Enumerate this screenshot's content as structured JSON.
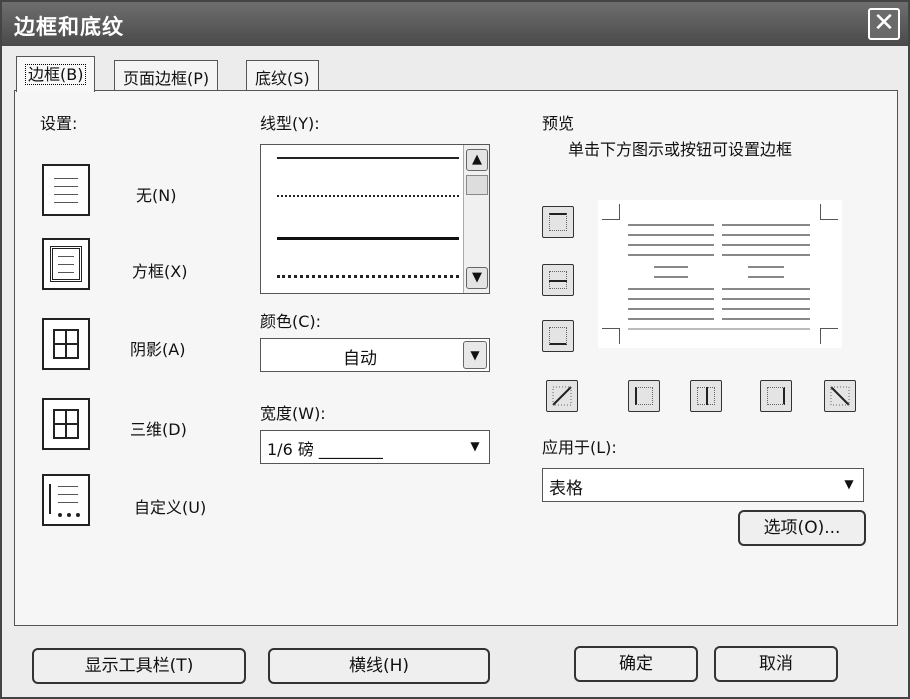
{
  "window": {
    "title": "边框和底纹"
  },
  "tabs": [
    "边框(B)",
    "页面边框(P)",
    "底纹(S)"
  ],
  "settings": {
    "label": "设置:",
    "items": [
      {
        "label": "无(N)",
        "icon": "none-border-icon"
      },
      {
        "label": "方框(X)",
        "icon": "box-border-icon"
      },
      {
        "label": "阴影(A)",
        "icon": "shadow-border-icon"
      },
      {
        "label": "三维(D)",
        "icon": "3d-border-icon"
      },
      {
        "label": "自定义(U)",
        "icon": "custom-border-icon"
      }
    ]
  },
  "line_style": {
    "label": "线型(Y):"
  },
  "color": {
    "label": "颜色(C):",
    "value": "自动"
  },
  "width": {
    "label": "宽度(W):",
    "value": "1/6 磅 ________"
  },
  "preview": {
    "label": "预览",
    "hint": "单击下方图示或按钮可设置边框"
  },
  "apply_to": {
    "label": "应用于(L):",
    "value": "表格"
  },
  "buttons": {
    "options": "选项(O)...",
    "show_toolbar": "显示工具栏(T)",
    "horizontal_line": "横线(H)",
    "ok": "确定",
    "cancel": "取消"
  }
}
